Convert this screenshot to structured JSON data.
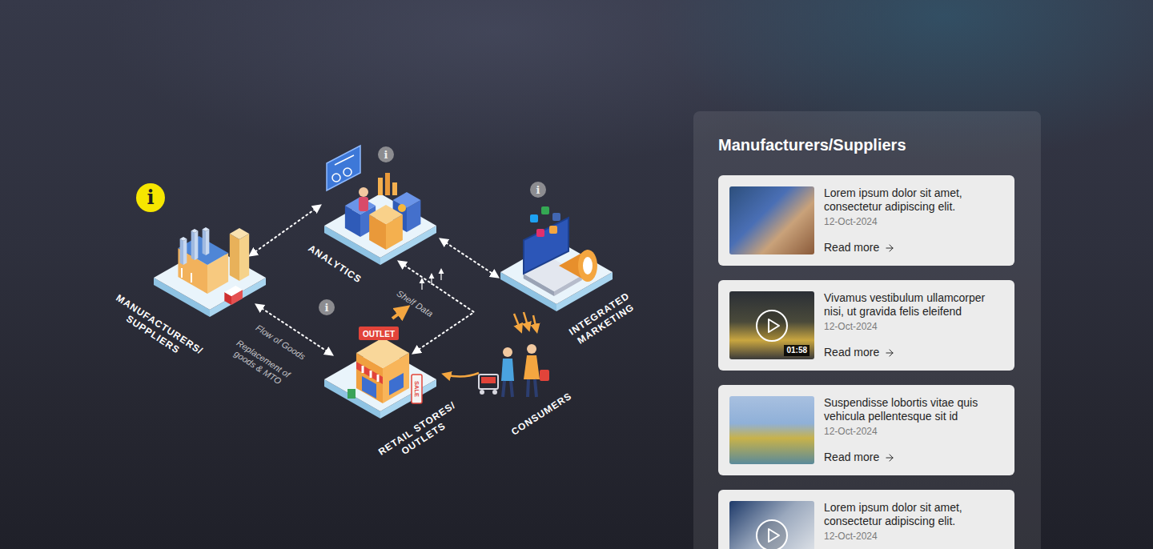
{
  "diagram": {
    "nodes": [
      {
        "kind": "factory",
        "label": [
          "MANUFACTURERS/",
          "SUPPLIERS"
        ],
        "info": {
          "glyph": "i",
          "selected": true
        },
        "signs": []
      },
      {
        "kind": "analytics",
        "label": [
          "ANALYTICS"
        ],
        "info": {
          "glyph": "i",
          "selected": false
        },
        "signs": []
      },
      {
        "kind": "marketing",
        "label": [
          "INTEGRATED",
          "MARKETING"
        ],
        "info": {
          "glyph": "i",
          "selected": false
        },
        "signs": []
      },
      {
        "kind": "retail",
        "label": [
          "RETAIL STORES/",
          "OUTLETS"
        ],
        "info": {
          "glyph": "i",
          "selected": false
        },
        "signs": [
          "OUTLET",
          "SALE"
        ]
      },
      {
        "kind": "consumers",
        "label": [
          "CONSUMERS"
        ],
        "info": null,
        "signs": []
      }
    ],
    "flows": [
      {
        "kind": "goods",
        "lines": [
          "Flow of Goods"
        ]
      },
      {
        "kind": "replacement",
        "lines": [
          "Replacement of",
          "goods & MTO"
        ]
      },
      {
        "kind": "shelf",
        "lines": [
          "Shelf Data"
        ]
      }
    ]
  },
  "panel": {
    "title": "Manufacturers/Suppliers",
    "items": [
      {
        "title": "Lorem ipsum dolor sit amet, consectetur adipiscing elit.",
        "date": "12-Oct-2024",
        "video": false,
        "duration": null,
        "link": "Read more"
      },
      {
        "title": "Vivamus vestibulum ullamcorper nisi, ut gravida felis eleifend",
        "date": "12-Oct-2024",
        "video": true,
        "duration": "01:58",
        "link": "Read more"
      },
      {
        "title": "Suspendisse lobortis vitae quis vehicula pellentesque sit id",
        "date": "12-Oct-2024",
        "video": false,
        "duration": null,
        "link": "Read more"
      },
      {
        "title": "Lorem ipsum dolor sit amet, consectetur adipiscing elit.",
        "date": "12-Oct-2024",
        "video": true,
        "duration": null,
        "link": null
      }
    ]
  }
}
